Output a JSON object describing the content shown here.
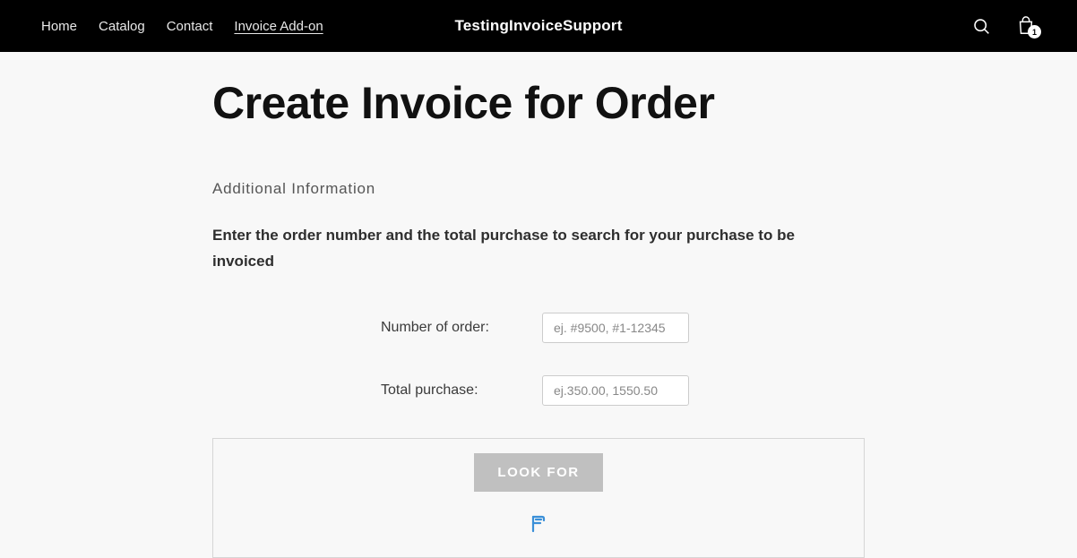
{
  "header": {
    "nav": [
      {
        "label": "Home",
        "active": false
      },
      {
        "label": "Catalog",
        "active": false
      },
      {
        "label": "Contact",
        "active": false
      },
      {
        "label": "Invoice Add-on",
        "active": true
      }
    ],
    "brand": "TestingInvoiceSupport",
    "cart_count": "1"
  },
  "page": {
    "title": "Create Invoice for Order",
    "subtitle": "Additional Information",
    "instructions": "Enter the order number and the total purchase to search for your purchase to be invoiced"
  },
  "form": {
    "order_label": "Number of order:",
    "order_placeholder": "ej. #9500, #1-12345",
    "total_label": "Total purchase:",
    "total_placeholder": "ej.350.00, 1550.50"
  },
  "actions": {
    "lookfor_label": "LOOK FOR"
  }
}
